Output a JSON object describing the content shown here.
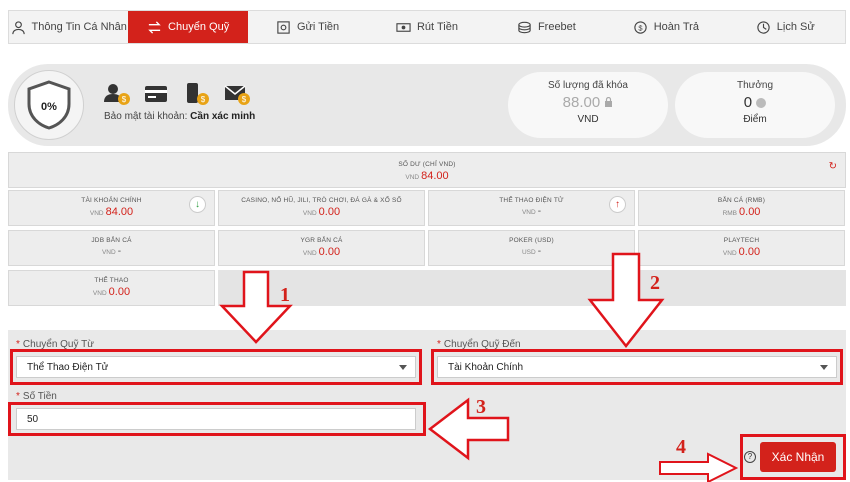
{
  "tabs": [
    {
      "label": "Thông Tin Cá Nhân",
      "icon": "user-icon",
      "active": false
    },
    {
      "label": "Chuyển Quỹ",
      "icon": "transfer-icon",
      "active": true
    },
    {
      "label": "Gửi Tiền",
      "icon": "safe-icon",
      "active": false
    },
    {
      "label": "Rút Tiền",
      "icon": "cash-icon",
      "active": false
    },
    {
      "label": "Freebet",
      "icon": "coins-icon",
      "active": false
    },
    {
      "label": "Hoàn Trả",
      "icon": "refund-icon",
      "active": false
    },
    {
      "label": "Lịch Sử",
      "icon": "history-icon",
      "active": false
    }
  ],
  "security": {
    "percent": "0%",
    "text_prefix": "Bảo mật tài khoản:",
    "text_status": "Cần xác minh",
    "icons": [
      "user-verify-icon",
      "card-icon",
      "phone-icon",
      "email-icon"
    ]
  },
  "locked": {
    "label": "Số lượng đã khóa",
    "value": "88.00",
    "unit": "VND"
  },
  "reward": {
    "label": "Thưởng",
    "value": "0",
    "unit": "Điểm"
  },
  "balance": {
    "title": "SỐ DƯ (CHỈ VND)",
    "currency": "VND",
    "value": "84.00"
  },
  "wallets": [
    {
      "title": "TÀI KHOẢN CHÍNH",
      "currency": "VND",
      "value": "84.00",
      "action": "down"
    },
    {
      "title": "CASINO, NỔ HŨ, JILI, TRÒ CHƠI, ĐÁ GÀ & XỔ SỐ",
      "currency": "VND",
      "value": "0.00"
    },
    {
      "title": "THỂ THAO ĐIỆN TỬ",
      "currency": "VND",
      "value": "-",
      "action": "up"
    },
    {
      "title": "BẮN CÁ (RMB)",
      "currency": "RMB",
      "value": "0.00"
    },
    {
      "title": "JDB BẮN CÁ",
      "currency": "VND",
      "value": "-"
    },
    {
      "title": "YGR BẮN CÁ",
      "currency": "VND",
      "value": "0.00"
    },
    {
      "title": "POKER (USD)",
      "currency": "USD",
      "value": "-"
    },
    {
      "title": "PLAYTECH",
      "currency": "VND",
      "value": "0.00"
    },
    {
      "title": "THỂ THAO",
      "currency": "VND",
      "value": "0.00"
    }
  ],
  "form": {
    "from_label": "Chuyển Quỹ Từ",
    "from_value": "Thể Thao Điện Tử",
    "to_label": "Chuyển Quỹ Đến",
    "to_value": "Tài Khoản Chính",
    "amount_label": "Số Tiền",
    "amount_value": "50",
    "confirm_label": "Xác Nhận",
    "required_mark": "*"
  },
  "annotations": [
    "1",
    "2",
    "3",
    "4"
  ],
  "colors": {
    "accent": "#d3221b",
    "annotation": "#e0141b"
  }
}
